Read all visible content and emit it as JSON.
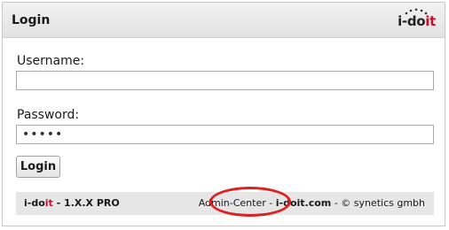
{
  "header": {
    "title": "Login",
    "logo_prefix": "i-do",
    "logo_accent": "it"
  },
  "form": {
    "username_label": "Username:",
    "username_value": "",
    "password_label": "Password:",
    "password_value": "•••••",
    "login_button": "Login"
  },
  "footer": {
    "brand_prefix": "i-do",
    "brand_accent": "it",
    "version": " - 1.X.X PRO",
    "admin_center": "Admin-Center",
    "separator1": " - ",
    "website": "i-doit.com",
    "separator2": " - ",
    "copyright": "© synetics gmbh"
  },
  "colors": {
    "accent": "#c8102e",
    "highlight": "#e02020"
  },
  "icons": [
    "logo-dots-icon"
  ]
}
